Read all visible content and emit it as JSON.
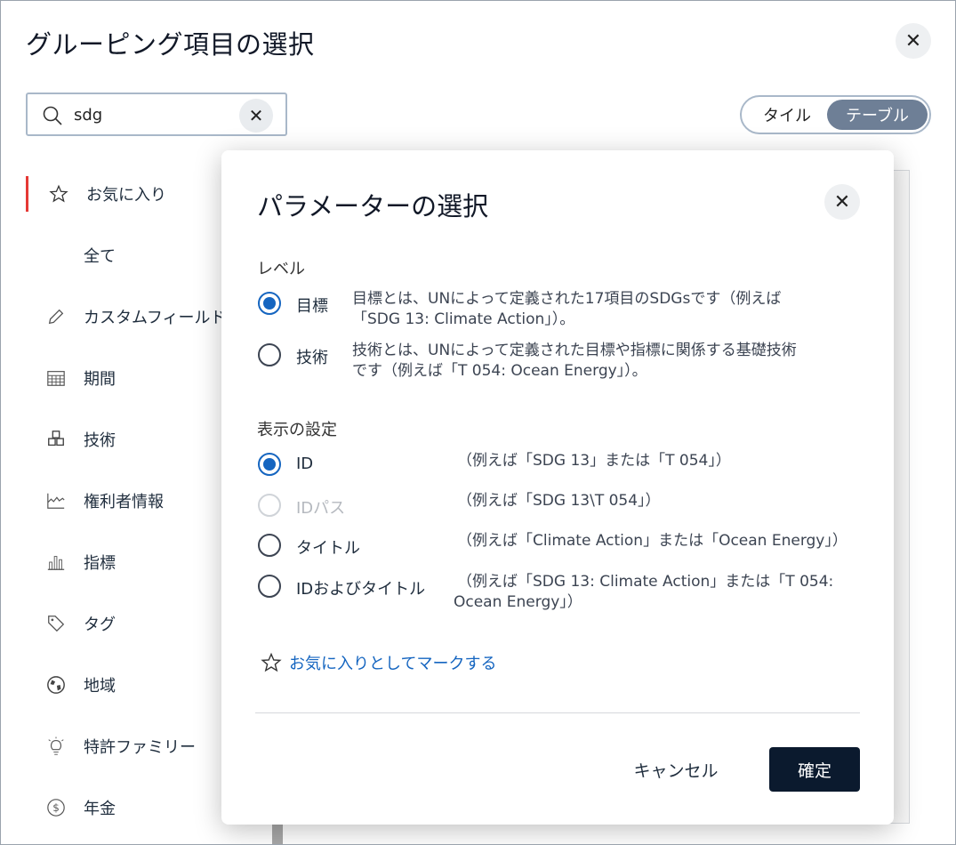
{
  "page": {
    "title": "グルーピング項目の選択",
    "close_icon": "close-icon"
  },
  "search": {
    "value": "sdg",
    "icon": "search-icon",
    "clear_icon": "clear-icon"
  },
  "view_toggle": {
    "options": [
      "タイル",
      "テーブル"
    ],
    "selected": "テーブル",
    "selected_color": "#6e7f96"
  },
  "sidebar": {
    "active_color": "#e53935",
    "items": [
      {
        "label": "お気に入り",
        "icon": "star-icon",
        "active": true
      },
      {
        "label": "全て",
        "icon": "",
        "active": false
      },
      {
        "label": "カスタムフィールド",
        "icon": "pencil-icon",
        "active": false
      },
      {
        "label": "期間",
        "icon": "calendar-icon",
        "active": false
      },
      {
        "label": "技術",
        "icon": "cubes-icon",
        "active": false
      },
      {
        "label": "権利者情報",
        "icon": "area-chart-icon",
        "active": false
      },
      {
        "label": "指標",
        "icon": "bar-chart-icon",
        "active": false
      },
      {
        "label": "タグ",
        "icon": "tag-icon",
        "active": false
      },
      {
        "label": "地域",
        "icon": "globe-icon",
        "active": false
      },
      {
        "label": "特許ファミリー",
        "icon": "lightbulb-icon",
        "active": false
      },
      {
        "label": "年金",
        "icon": "dollar-circle-icon",
        "active": false
      }
    ]
  },
  "dialog": {
    "title": "パラメーターの選択",
    "level": {
      "label": "レベル",
      "options": [
        {
          "label": "目標",
          "checked": true,
          "desc_1": "目標とは、UNによって定義された17項目のSDGsです（例えば",
          "desc_2": "「SDG 13: Climate Action」）。"
        },
        {
          "label": "技術",
          "checked": false,
          "desc_1": "技術とは、UNによって定義された目標や指標に関係する基礎技術",
          "desc_2": "です（例えば「T 054: Ocean Energy」）。"
        }
      ]
    },
    "display": {
      "label": "表示の設定",
      "options": [
        {
          "label": "ID",
          "checked": true,
          "disabled": false,
          "desc_1": "（例えば「SDG 13」または「T 054」）",
          "desc_2": ""
        },
        {
          "label": "IDパス",
          "checked": false,
          "disabled": true,
          "desc_1": "（例えば「SDG 13\\T 054」）",
          "desc_2": ""
        },
        {
          "label": "タイトル",
          "checked": false,
          "disabled": false,
          "desc_1": "（例えば「Climate Action」または「Ocean Energy」）",
          "desc_2": ""
        },
        {
          "label": "IDおよびタイトル",
          "checked": false,
          "disabled": false,
          "desc_1": "（例えば「SDG 13: Climate Action」または「T 054:",
          "desc_2": "Ocean Energy」）"
        }
      ]
    },
    "favorite_link": "お気に入りとしてマークする",
    "cancel_label": "キャンセル",
    "confirm_label": "確定",
    "accent_color": "#1565c0",
    "confirm_color": "#0b1a2e"
  }
}
